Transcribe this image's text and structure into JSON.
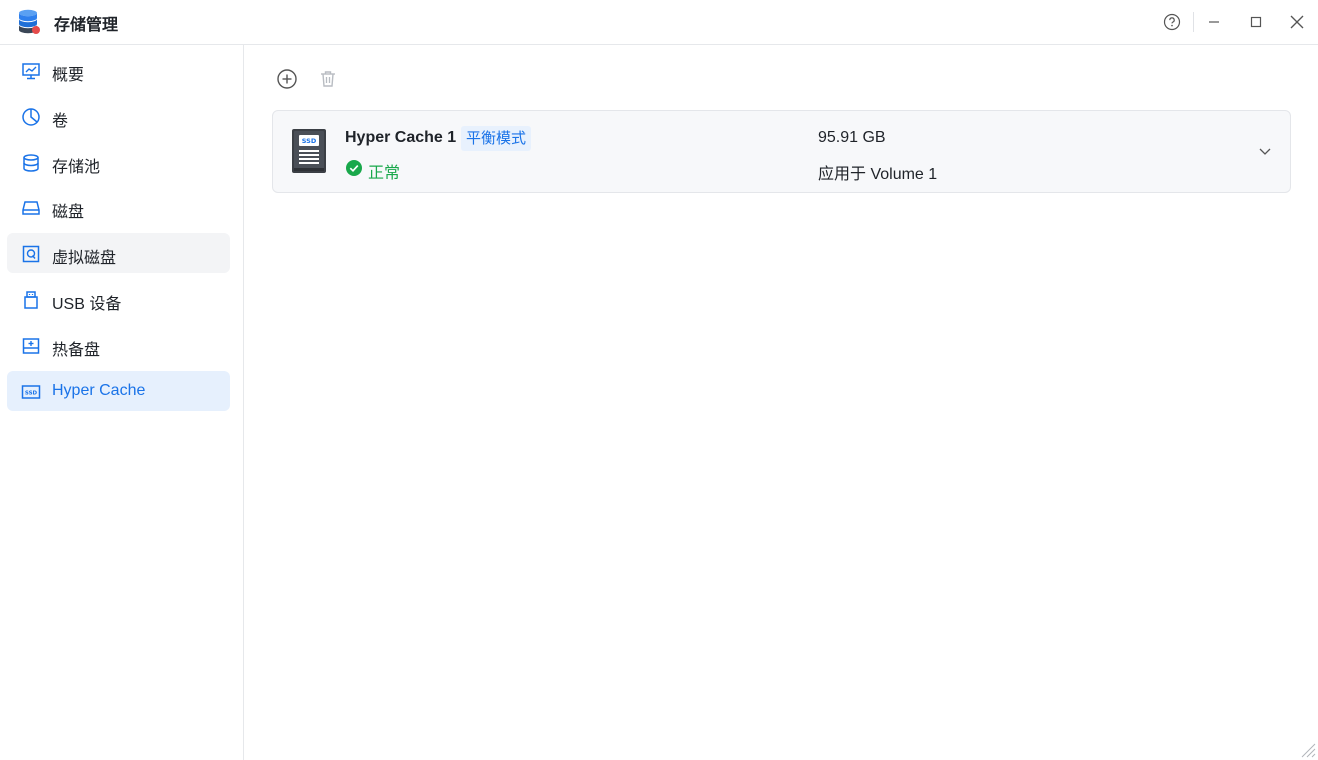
{
  "window": {
    "title": "存储管理",
    "app_icon": "storage-database-icon",
    "controls": [
      "help-icon",
      "minimize-icon",
      "maximize-icon",
      "close-icon"
    ]
  },
  "sidebar": {
    "items": [
      {
        "label": "概要",
        "icon": "monitor-chart-icon",
        "state": "normal"
      },
      {
        "label": "卷",
        "icon": "pie-chart-icon",
        "state": "normal"
      },
      {
        "label": "存储池",
        "icon": "database-icon",
        "state": "normal"
      },
      {
        "label": "磁盘",
        "icon": "hard-drive-icon",
        "state": "normal"
      },
      {
        "label": "虚拟磁盘",
        "icon": "virtual-disk-icon",
        "state": "hover"
      },
      {
        "label": "USB 设备",
        "icon": "usb-icon",
        "state": "normal"
      },
      {
        "label": "热备盘",
        "icon": "hot-spare-icon",
        "state": "normal"
      },
      {
        "label": "Hyper Cache",
        "icon": "ssd-icon",
        "state": "active"
      }
    ]
  },
  "toolbar": {
    "add_icon": "add-circle-icon",
    "delete_icon": "trash-icon"
  },
  "cache": {
    "name": "Hyper Cache 1",
    "mode": "平衡模式",
    "status": "正常",
    "capacity": "95.91 GB",
    "applied_to": "应用于 Volume 1",
    "drive_label": "SSD"
  },
  "colors": {
    "accent": "#1a73e8",
    "active_bg": "#e6f0fd",
    "status_ok": "#19a84b",
    "card_bg": "#f7f8fa"
  }
}
